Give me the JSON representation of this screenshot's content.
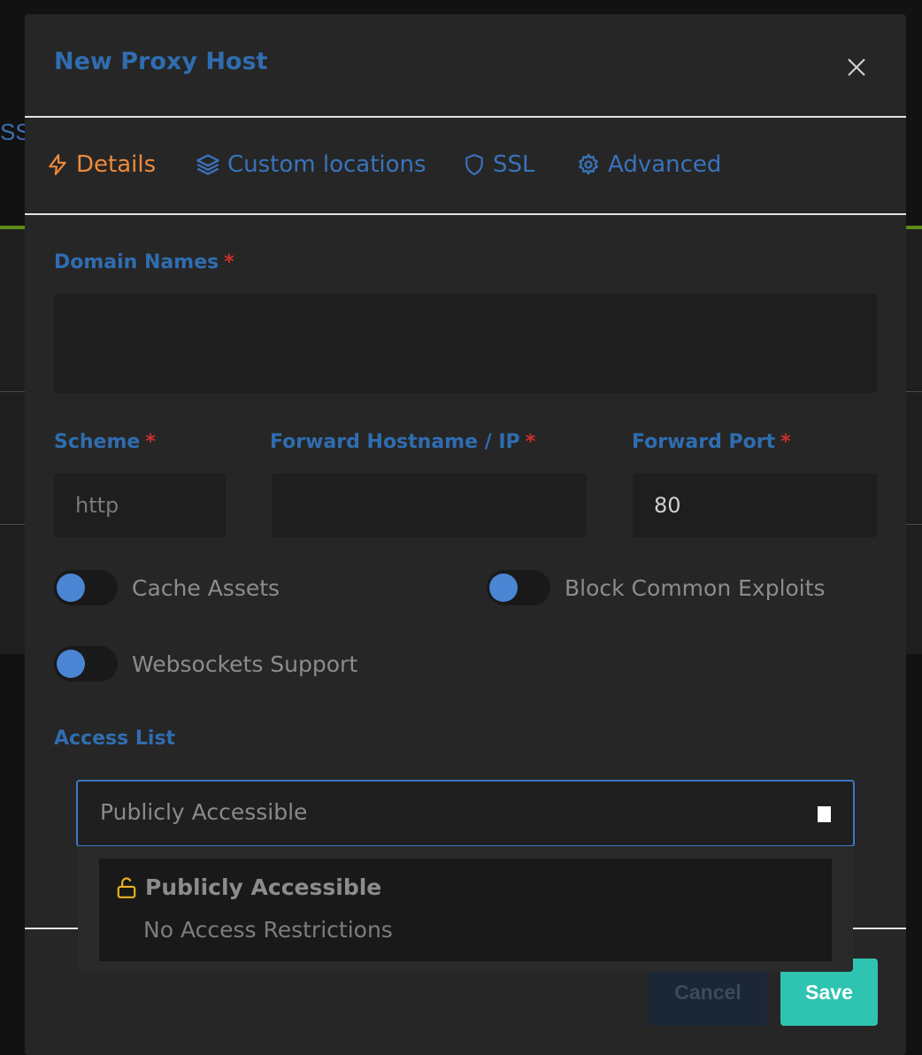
{
  "background": {
    "partial_tab_text": "SSL"
  },
  "modal": {
    "title": "New Proxy Host"
  },
  "tabs": [
    {
      "label": "Details",
      "icon": "bolt-icon",
      "active": true
    },
    {
      "label": "Custom locations",
      "icon": "layers-icon",
      "active": false
    },
    {
      "label": "SSL",
      "icon": "shield-icon",
      "active": false
    },
    {
      "label": "Advanced",
      "icon": "gear-icon",
      "active": false
    }
  ],
  "form": {
    "domain_names_label": "Domain Names",
    "domain_names_value": "",
    "scheme_label": "Scheme",
    "scheme_placeholder": "http",
    "hostname_label": "Forward Hostname / IP",
    "hostname_value": "",
    "port_label": "Forward Port",
    "port_value": "80",
    "required_mark": "*",
    "toggles": {
      "cache_assets": "Cache Assets",
      "block_exploits": "Block Common Exploits",
      "websockets": "Websockets Support"
    },
    "access_list_label": "Access List",
    "access_list_selected": "Publicly Accessible",
    "access_list_options": [
      {
        "title": "Publicly Accessible",
        "description": "No Access Restrictions",
        "icon": "unlock-icon"
      }
    ]
  },
  "footer": {
    "cancel_label": "Cancel",
    "save_label": "Save"
  },
  "colors": {
    "accent_blue": "#2f6db0",
    "active_tab": "#ee8a3a",
    "required": "#cd2e2e",
    "save_button": "#2fc4b2",
    "unlock_icon": "#e8b222"
  }
}
